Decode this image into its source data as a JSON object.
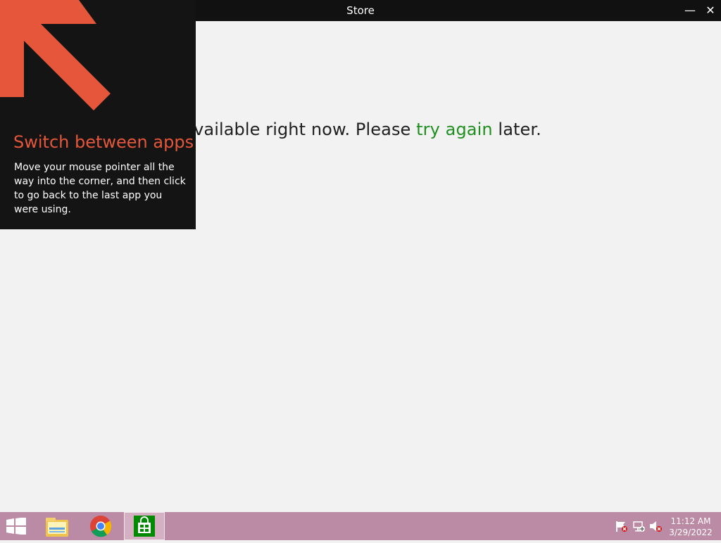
{
  "window": {
    "title": "Store",
    "minimize_glyph": "—",
    "close_glyph": "✕"
  },
  "content": {
    "message_prefix": "n’t available right now. Please ",
    "message_link": "try again",
    "message_suffix": " later."
  },
  "tutorial": {
    "heading": "Switch between apps",
    "body": "Move your mouse pointer all the way into the corner, and then click to go back to the last app you were using.",
    "arrow_color": "#e5563a"
  },
  "taskbar": {
    "apps": [
      {
        "name": "file-explorer-icon"
      },
      {
        "name": "chrome-icon"
      },
      {
        "name": "store-icon",
        "active": true
      }
    ],
    "tray": {
      "icons": [
        "flag-icon",
        "network-icon",
        "volume-muted-icon"
      ]
    },
    "clock": {
      "time": "11:12 AM",
      "date": "3/29/2022"
    },
    "color": "#bb8aa4"
  }
}
